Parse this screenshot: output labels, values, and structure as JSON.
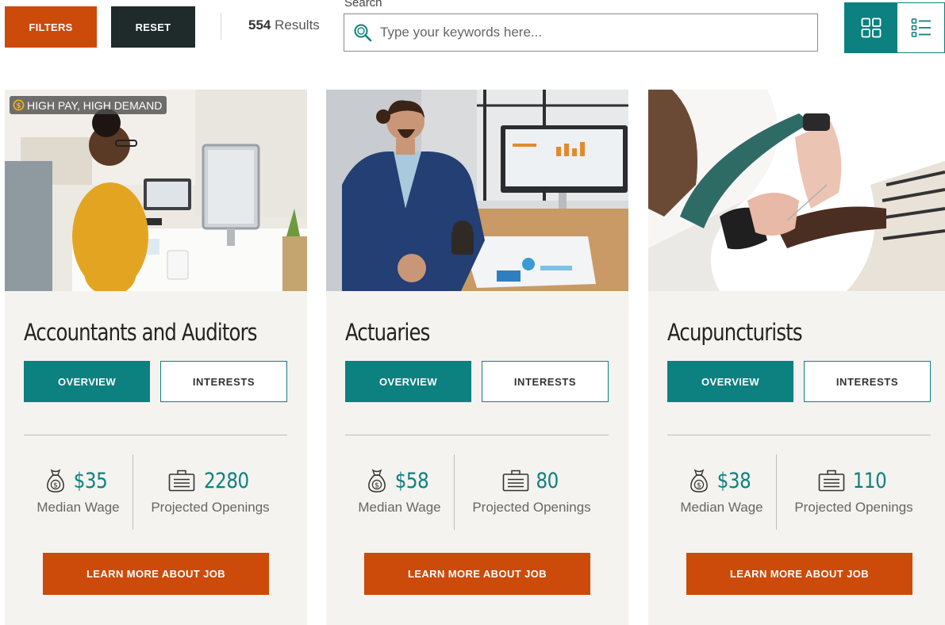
{
  "toolbar": {
    "filters_label": "FILTERS",
    "reset_label": "RESET",
    "results_count": "554",
    "results_word": "Results",
    "search_label": "Search",
    "search_placeholder": "Type your keywords here..."
  },
  "colors": {
    "accent_teal": "#0d8080",
    "accent_orange": "#cc4a0a",
    "dark": "#1f2a2a",
    "card_bg": "#f4f3ef"
  },
  "cards": [
    {
      "badge": "HIGH PAY, HIGH DEMAND",
      "title": "Accountants and Auditors",
      "overview_label": "OVERVIEW",
      "interests_label": "INTERESTS",
      "wage": "$35",
      "wage_label": "Median Wage",
      "openings": "2280",
      "openings_label": "Projected Openings",
      "cta_label": "LEARN MORE ABOUT JOB"
    },
    {
      "title": "Actuaries",
      "overview_label": "OVERVIEW",
      "interests_label": "INTERESTS",
      "wage": "$58",
      "wage_label": "Median Wage",
      "openings": "80",
      "openings_label": "Projected Openings",
      "cta_label": "LEARN MORE ABOUT JOB"
    },
    {
      "title": "Acupuncturists",
      "overview_label": "OVERVIEW",
      "interests_label": "INTERESTS",
      "wage": "$38",
      "wage_label": "Median Wage",
      "openings": "110",
      "openings_label": "Projected Openings",
      "cta_label": "LEARN MORE ABOUT JOB"
    }
  ]
}
